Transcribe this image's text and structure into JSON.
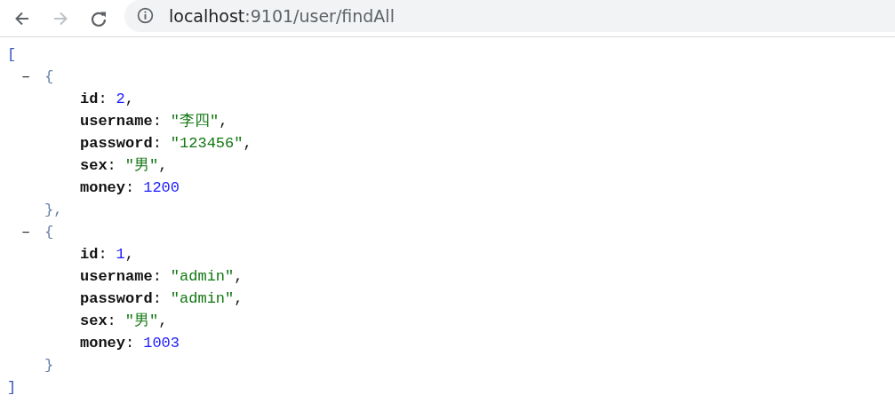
{
  "toolbar": {
    "back": {
      "disabled": false
    },
    "forward": {
      "disabled": true
    },
    "address": {
      "host": "localhost",
      "path": ":9101/user/findAll"
    }
  },
  "json_view": {
    "open": "[",
    "close": "]",
    "items": [
      {
        "toggle": "–",
        "open": "{",
        "close": "},",
        "expanded": true,
        "fields": [
          {
            "key": "id",
            "colon": ":",
            "value": "2",
            "comma": ",",
            "kind": "number"
          },
          {
            "key": "username",
            "colon": ":",
            "value": "\"李四\"",
            "comma": ",",
            "kind": "string"
          },
          {
            "key": "password",
            "colon": ":",
            "value": "\"123456\"",
            "comma": ",",
            "kind": "string"
          },
          {
            "key": "sex",
            "colon": ":",
            "value": "\"男\"",
            "comma": ",",
            "kind": "string"
          },
          {
            "key": "money",
            "colon": ":",
            "value": "1200",
            "kind": "number"
          }
        ]
      },
      {
        "toggle": "–",
        "open": "{",
        "close": "}",
        "expanded": true,
        "fields": [
          {
            "key": "id",
            "colon": ":",
            "value": "1",
            "comma": ",",
            "kind": "number"
          },
          {
            "key": "username",
            "colon": ":",
            "value": "\"admin\"",
            "comma": ",",
            "kind": "string"
          },
          {
            "key": "password",
            "colon": ":",
            "value": "\"admin\"",
            "comma": ",",
            "kind": "string"
          },
          {
            "key": "sex",
            "colon": ":",
            "value": "\"男\"",
            "comma": ",",
            "kind": "string"
          },
          {
            "key": "money",
            "colon": ":",
            "value": "1003",
            "kind": "number"
          }
        ]
      }
    ]
  }
}
